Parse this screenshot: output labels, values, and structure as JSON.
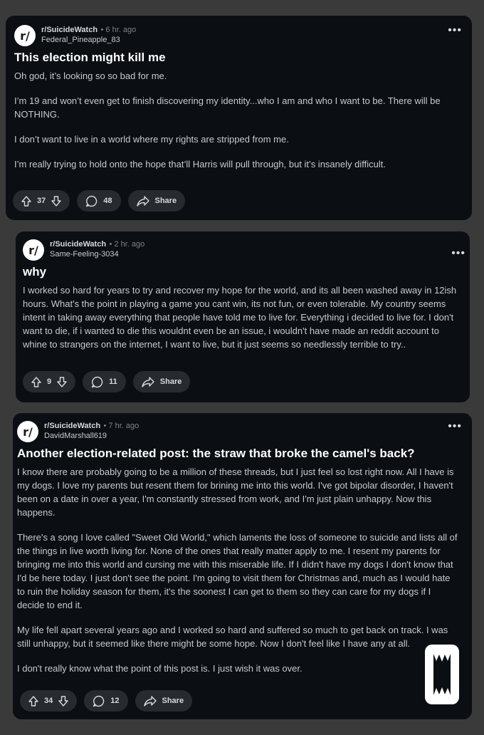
{
  "posts": [
    {
      "subreddit": "r/SuicideWatch",
      "time": "• 6 hr. ago",
      "user": "Federal_Pineapple_83",
      "title": "This election might kill me",
      "paragraphs": [
        "Oh god, it’s looking so so bad for me.",
        "I’m 19 and won’t even get to finish discovering my identity...who I am and who I want to be. There will be NOTHING.",
        "I don’t want to live in a world where my rights are stripped from me.",
        "I’m really trying to hold onto the hope that’ll Harris will pull through, but it’s insanely difficult."
      ],
      "votes": "37",
      "comments": "48",
      "share": "Share"
    },
    {
      "subreddit": "r/SuicideWatch",
      "time": "• 2 hr. ago",
      "user": "Same-Feeling-3034",
      "title": "why",
      "paragraphs": [
        "I worked so hard for years to try and recover my hope for the world, and its all been washed away in 12ish hours. What's the point in playing a game you cant win, its not fun, or even tolerable. My country seems intent in taking away everything that people have told me to live for. Everything i decided to live for. I don't want to die, if i wanted to die this wouldnt even be an issue, i wouldn't have made an reddit account to whine to strangers on the internet, I want to live, but it just seems so needlessly terrible to try.."
      ],
      "votes": "9",
      "comments": "11",
      "share": "Share"
    },
    {
      "subreddit": "r/SuicideWatch",
      "time": "• 7 hr. ago",
      "user": "DavidMarshall619",
      "title": "Another election-related post: the straw that broke the camel's back?",
      "paragraphs": [
        "I know there are probably going to be a million of these threads, but I just feel so lost right now. All I have is my dogs. I love my parents but resent them for brining me into this world. I've got bipolar disorder, I haven't been on a date in over a year, I'm constantly stressed from work, and I'm just plain unhappy. Now this happens.",
        "There's a song I love called \"Sweet Old World,\" which laments the loss of someone to suicide and lists all of the things in live worth living for. None of the ones that really matter apply to me. I resent my parents for bringing me into this world and cursing me with this miserable life. If I didn't have my dogs I don't know that I'd be here today. I just don't see the point. I'm going to visit them for Christmas and, much as I would hate to ruin the holiday season for them, it's the soonest I can get to them so they can care for my dogs if I decide to end it.",
        "My life fell apart several years ago and I worked so hard and suffered so much to get back on track. I was still unhappy, but it seemed like there might be some hope. Now I don't feel like I have any at all.",
        "I don't really know what the point of this post is. I just wish it was over."
      ],
      "votes": "34",
      "comments": "12",
      "share": "Share"
    }
  ],
  "icons": {
    "avatar": "r/",
    "more": "•••",
    "upvote": "upvote-arrow-icon",
    "downvote": "downvote-arrow-icon",
    "comment": "comment-bubble-icon",
    "share": "share-arrow-icon",
    "watermark": "watermark-logo-icon"
  },
  "colors": {
    "background": "#3a3a3a",
    "card": "#0b0e12",
    "pill": "#272a2e",
    "text": "#d7dadc"
  }
}
